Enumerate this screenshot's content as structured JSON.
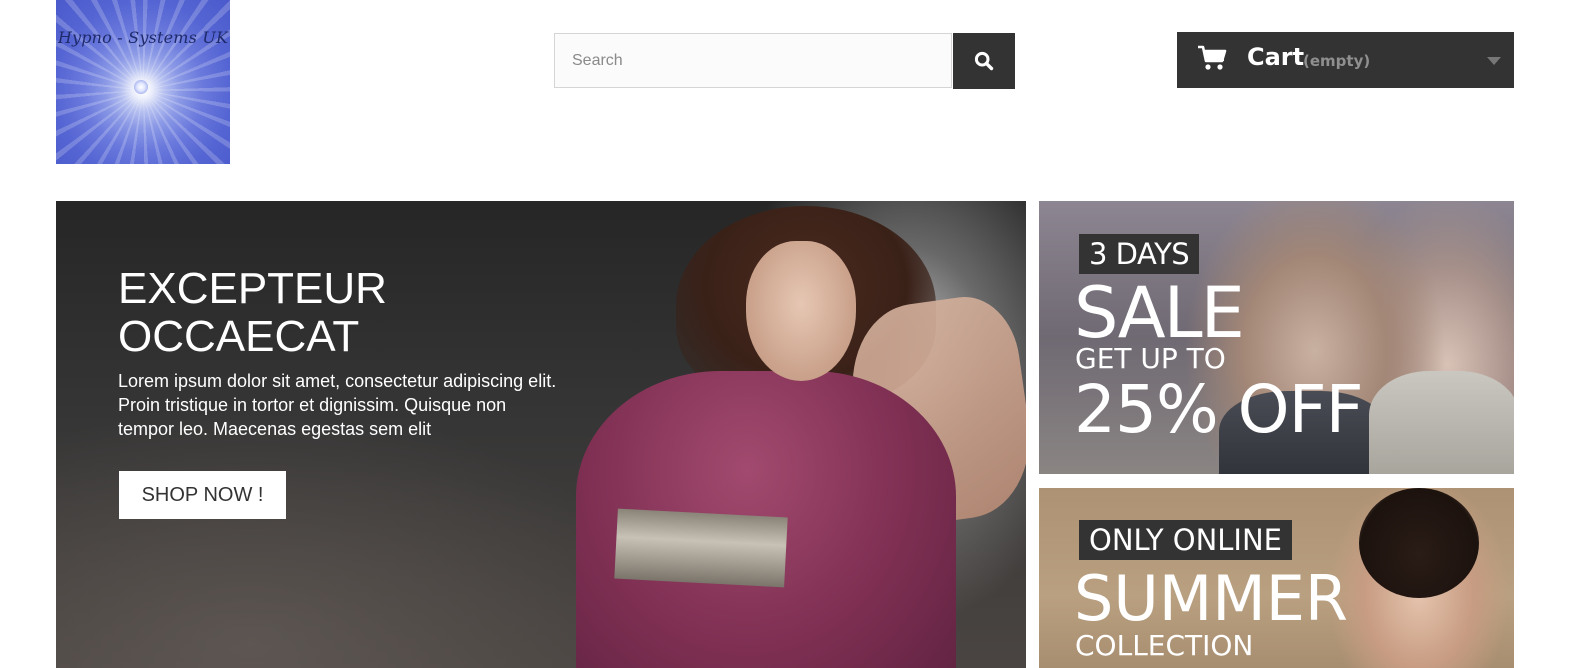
{
  "header": {
    "logo_text": "Hypno - Systems UK",
    "search": {
      "placeholder": "Search",
      "value": ""
    },
    "cart": {
      "label": "Cart",
      "status": "(empty)"
    }
  },
  "slider": {
    "title": "EXCEPTEUR\nOCCAECAT",
    "description": "Lorem ipsum dolor sit amet, consectetur adipiscing elit. Proin tristique in tortor et dignissim. Quisque non tempor leo. Maecenas egestas sem elit",
    "button_label": "SHOP NOW !"
  },
  "banners": {
    "sale": {
      "tag": "3 DAYS",
      "line1": "SALE",
      "line2": "GET UP TO",
      "line3": "25% OFF"
    },
    "summer": {
      "tag": "ONLY ONLINE",
      "line1": "SUMMER",
      "line2": "COLLECTION"
    }
  },
  "colors": {
    "dark": "#333333",
    "logo_blue": "#5a6ad6"
  },
  "icons": [
    "search-icon",
    "cart-icon",
    "caret-down-icon"
  ]
}
